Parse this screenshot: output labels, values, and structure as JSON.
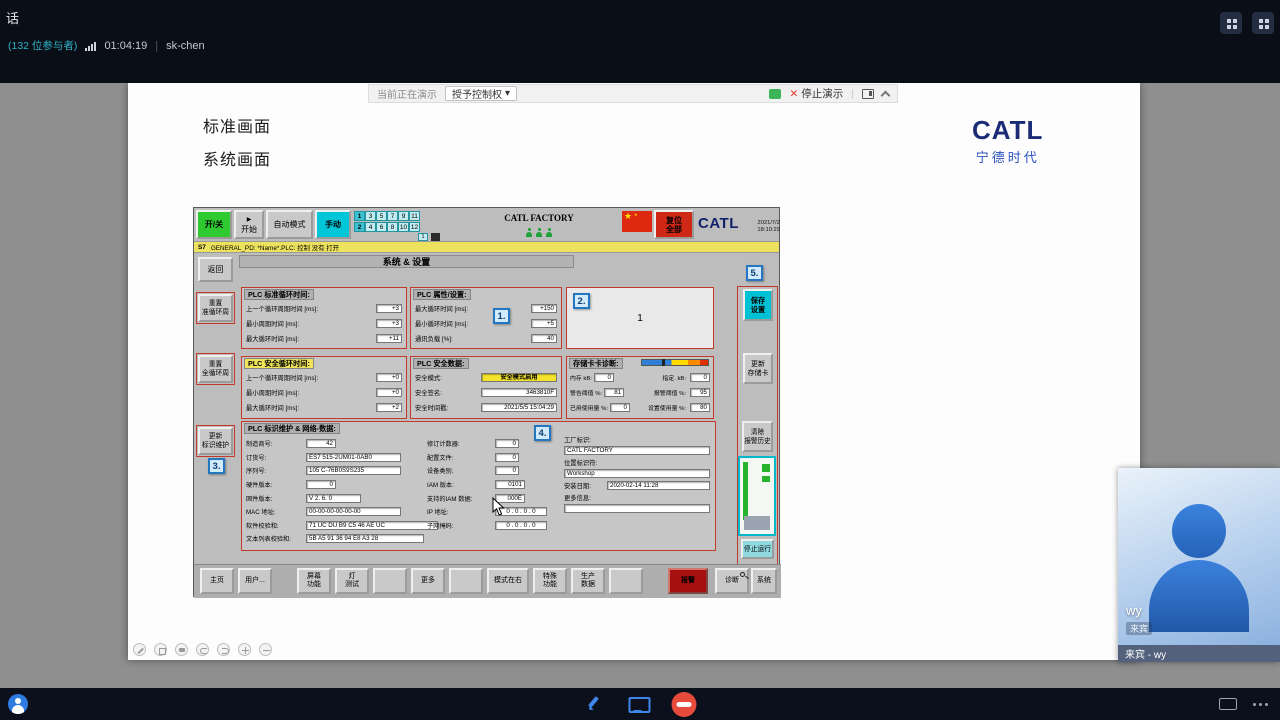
{
  "colors": {
    "accent_cyan": "#00c2d4",
    "hmi_green": "#2ec92e",
    "alarm_red": "#a80f0f",
    "flag_red": "#de2910",
    "catl_blue": "#1c2b76",
    "link_blue": "#2b50c0",
    "marker_blue": "#2576c0",
    "participants_cyan": "#2fb3c6"
  },
  "icons": {
    "dropdown": "▾",
    "close": "✕",
    "play": "▶",
    "star_big": "★",
    "star_small": "★",
    "sep": "|"
  },
  "topbar": {
    "window_title": "话",
    "participants": "(132 位参与者)",
    "duration": "01:04:19",
    "presenter": "sk-chen"
  },
  "share_toolbar": {
    "presenting": "当前正在演示",
    "grant_control": "授予控制权",
    "stop_label": "停止演示"
  },
  "doc": {
    "link_standard": "标准画面",
    "link_system": "系统画面",
    "logo_title": "CATL",
    "logo_subtitle": "宁德时代"
  },
  "hmi": {
    "header": {
      "power": "开/关",
      "start": "开始",
      "auto": "自动模式",
      "manual": "手动",
      "grid_row1": [
        "1",
        "3",
        "5",
        "7",
        "9",
        "11"
      ],
      "grid_row2": [
        "2",
        "4",
        "6",
        "8",
        "10",
        "12"
      ],
      "grid_extra": "1",
      "factory": "CATL FACTORY",
      "reset_line1": "复位",
      "reset_line2": "全部",
      "logo": "CATL",
      "datetime": "2021/7/2 18:10:29"
    },
    "status": {
      "tag": "S7",
      "text": "GENERAL_PD: *Name*.PLC: 控制 没有 打开"
    },
    "screen_title": "系统 & 设置",
    "nav": {
      "back": "返回",
      "reset_std_1": "重置",
      "reset_std_2": "准循环周",
      "reset_all_1": "重置",
      "reset_all_2": "全循环周",
      "update_ident_1": "更新",
      "update_ident_2": "标识维护"
    },
    "markers": {
      "m1": "1.",
      "m2": "2.",
      "m3": "3.",
      "m4": "4.",
      "m5": "5."
    },
    "std_cycle": {
      "title": "PLC 标准循环时间:",
      "rows": [
        {
          "label": "上一个循环周期时间 [ms]:",
          "value": "+3"
        },
        {
          "label": "最小周期时间 [ms]:",
          "value": "+3"
        },
        {
          "label": "最大循环时间 [ms]:",
          "value": "+11"
        }
      ]
    },
    "props": {
      "title": "PLC 属性/设置:",
      "rows": [
        {
          "label": "最大循环时间 [ms]:",
          "value": "+150"
        },
        {
          "label": "最小循环时间 [ms]:",
          "value": "+5"
        },
        {
          "label": "通讯负载 [%]:",
          "value": "40"
        }
      ]
    },
    "box_value": "1",
    "safety_cycle": {
      "title": "PLC 安全循环时间:",
      "rows": [
        {
          "label": "上一个循环周期时间 [ms]:",
          "value": "+0"
        },
        {
          "label": "最小周期时间 [ms]:",
          "value": "+0"
        },
        {
          "label": "最大循环时间 [ms]:",
          "value": "+2"
        }
      ]
    },
    "safety_data": {
      "title": "PLC 安全数据:",
      "rows": [
        {
          "label": "安全模式:",
          "value": "安全模式启用"
        },
        {
          "label": "安全签名:",
          "value": "3463810F"
        },
        {
          "label": "安全时间戳:",
          "value": "2021/5/5 15:04:29"
        }
      ]
    },
    "memcard": {
      "title": "存储卡卡诊断:",
      "rows": [
        {
          "label1": "内存 kB:",
          "value1": "0",
          "label2": "指定. kB:",
          "value2": "0"
        },
        {
          "label1": "警告阈值 %:",
          "value1": "81",
          "label2": "报警阈值 %:",
          "value2": "95"
        },
        {
          "label1": "已用使用量 %:",
          "value1": "0",
          "label2": "设置使用量 %:",
          "value2": "80"
        }
      ]
    },
    "ident": {
      "title": "PLC 标识维护 & 网络-数据:",
      "left": [
        {
          "label": "制造商号:",
          "value": "42"
        },
        {
          "label": "订货号:",
          "value": "ES7 515-2UM01-0AB0"
        },
        {
          "label": "序列号:",
          "value": "105 C-76B0S9S235"
        },
        {
          "label": "硬件版本:",
          "value": "0"
        },
        {
          "label": "固件版本:",
          "value": "V 2. 6. 0"
        },
        {
          "label": "MAC 地址:",
          "value": "00-00-00-00-00-00"
        },
        {
          "label": "软件校验和:",
          "value": "71 UC DU B9 C5 46 AE UC"
        },
        {
          "label": "文本列表校验和:",
          "value": "5B A5 91 36 94 E8 A3 28"
        }
      ],
      "mid": [
        {
          "label": "修订计数器:",
          "value": "0"
        },
        {
          "label": "配置文件:",
          "value": "0"
        },
        {
          "label": "设备类别:",
          "value": "0"
        },
        {
          "label": "IAM 版本:",
          "value": "0101"
        },
        {
          "label": "支持的IAM 数据:",
          "value": "000E"
        },
        {
          "label": "IP 地址:",
          "value": "0 . 0 . 0 . 0"
        },
        {
          "label": "子网掩码:",
          "value": "0 . 0 . 0 . 0"
        }
      ],
      "right": {
        "factory_label": "工厂标识:",
        "factory_value": "CATL FACTORY",
        "location_label": "位置标识符:",
        "location_value": "Workshop",
        "install_label": "安装日期:",
        "install_value": "2020-02-14 11:28",
        "more_label": "更多信息:",
        "more_value": ""
      }
    },
    "side": {
      "save_1": "保存",
      "save_2": "设置",
      "update_1": "更新",
      "update_2": "存储卡",
      "clear_1": "清除",
      "clear_2": "报警历史",
      "stop_run": "停止运行"
    },
    "bottom": [
      {
        "l1": "主页",
        "l2": ""
      },
      {
        "l1": "用户...",
        "l2": ""
      },
      {
        "l1": "屏幕",
        "l2": "功能"
      },
      {
        "l1": "灯",
        "l2": "测试"
      },
      {
        "l1": "",
        "l2": ""
      },
      {
        "l1": "更多",
        "l2": ""
      },
      {
        "l1": "",
        "l2": ""
      },
      {
        "l1": "模式在右",
        "l2": ""
      },
      {
        "l1": "特殊",
        "l2": "功能"
      },
      {
        "l1": "生产",
        "l2": "数据"
      },
      {
        "l1": "",
        "l2": ""
      },
      {
        "l1": "报警",
        "l2": ""
      },
      {
        "l1": "诊断",
        "l2": ""
      },
      {
        "l1": "系统",
        "l2": ""
      }
    ]
  },
  "overlay": {
    "name": "wy",
    "role": "来宾",
    "strip": "来宾 - wy"
  }
}
